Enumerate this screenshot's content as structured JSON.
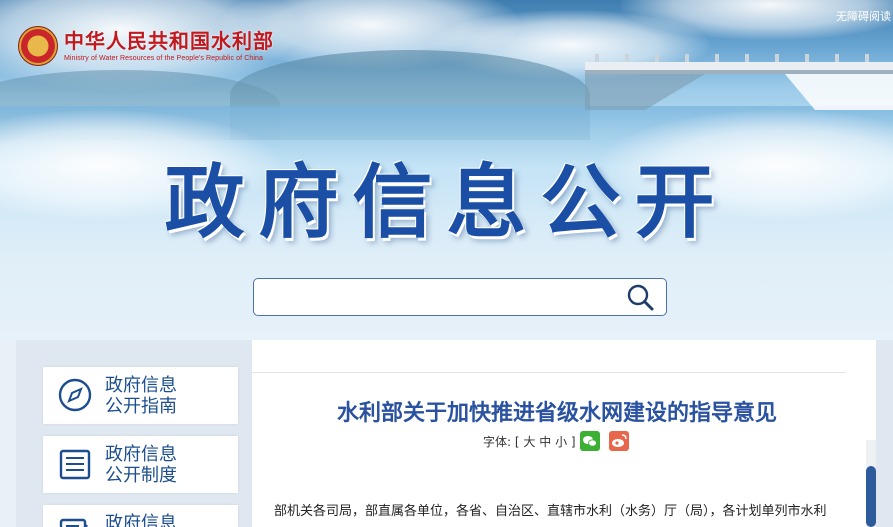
{
  "header": {
    "logo_cn": "中华人民共和国水利部",
    "logo_en": "Ministry of Water Resources of the People's Republic of China",
    "accessibility": "无障碍阅读",
    "title": "政府信息公开"
  },
  "search": {
    "placeholder": "",
    "value": ""
  },
  "sidebar": {
    "items": [
      {
        "line1": "政府信息",
        "line2": "公开指南",
        "icon": "compass-icon"
      },
      {
        "line1": "政府信息",
        "line2": "公开制度",
        "icon": "document-list-icon"
      },
      {
        "line1": "政府信息",
        "line2": "",
        "icon": "document-edit-icon"
      }
    ]
  },
  "article": {
    "title": "水利部关于加快推进省级水网建设的指导意见",
    "font_label": "字体:",
    "font_bracket_open": "[",
    "font_large": "大",
    "font_medium": "中",
    "font_small": "小",
    "font_bracket_close": "]",
    "share_wechat_icon": "wechat-icon",
    "share_weibo_icon": "weibo-icon",
    "body_first_line": "部机关各司局，部直属各单位，各省、自治区、直辖市水利（水务）厅（局），各计划单列市水利"
  },
  "colors": {
    "title_blue": "#1a4fa5",
    "logo_red": "#c01a1f",
    "sidebar_text": "#1c4e8f",
    "article_title": "#2a52a0",
    "wechat_green": "#3cb034",
    "weibo_red": "#e8674c",
    "scroll_thumb": "#2d5a9a"
  }
}
